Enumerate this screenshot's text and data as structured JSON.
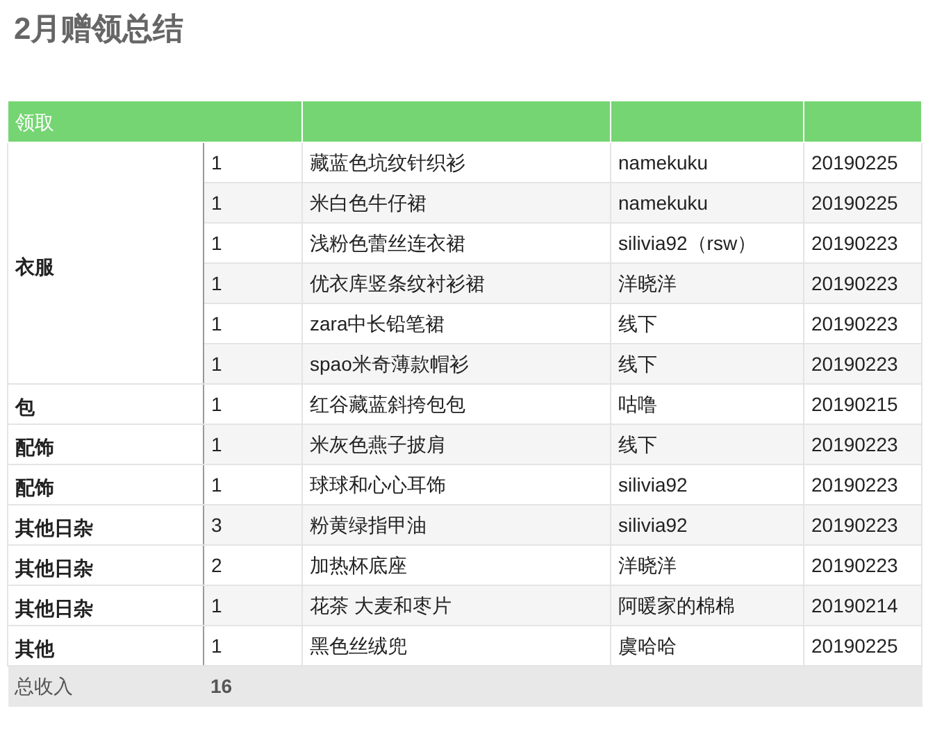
{
  "title": "2月赠领总结",
  "table": {
    "header": "领取",
    "groups": [
      {
        "category": "衣服",
        "items": [
          {
            "qty": "1",
            "item": "藏蓝色坑纹针织衫",
            "source": "namekuku",
            "date": "20190225"
          },
          {
            "qty": "1",
            "item": "米白色牛仔裙",
            "source": "namekuku",
            "date": "20190225"
          },
          {
            "qty": "1",
            "item": "浅粉色蕾丝连衣裙",
            "source": "silivia92（rsw）",
            "date": "20190223"
          },
          {
            "qty": "1",
            "item": "优衣库竖条纹衬衫裙",
            "source": "洋晓洋",
            "date": "20190223"
          },
          {
            "qty": "1",
            "item": "zara中长铅笔裙",
            "source": "线下",
            "date": "20190223"
          },
          {
            "qty": "1",
            "item": "spao米奇薄款帽衫",
            "source": "线下",
            "date": "20190223"
          }
        ]
      },
      {
        "category": "包",
        "items": [
          {
            "qty": "1",
            "item": "红谷藏蓝斜挎包包",
            "source": "咕噜",
            "date": "20190215"
          }
        ]
      },
      {
        "category": "配饰",
        "items": [
          {
            "qty": "1",
            "item": "米灰色燕子披肩",
            "source": "线下",
            "date": "20190223"
          }
        ]
      },
      {
        "category": "配饰",
        "items": [
          {
            "qty": "1",
            "item": "球球和心心耳饰",
            "source": "silivia92",
            "date": "20190223"
          }
        ]
      },
      {
        "category": "其他日杂",
        "items": [
          {
            "qty": "3",
            "item": "粉黄绿指甲油",
            "source": "silivia92",
            "date": "20190223"
          }
        ]
      },
      {
        "category": "其他日杂",
        "items": [
          {
            "qty": "2",
            "item": "加热杯底座",
            "source": "洋晓洋",
            "date": "20190223"
          }
        ]
      },
      {
        "category": "其他日杂",
        "items": [
          {
            "qty": "1",
            "item": "花茶 大麦和枣片",
            "source": "阿暖家的棉棉",
            "date": "20190214"
          }
        ]
      },
      {
        "category": "其他",
        "items": [
          {
            "qty": "1",
            "item": "黑色丝绒兜",
            "source": "虞哈哈",
            "date": "20190225"
          }
        ]
      }
    ],
    "footer": {
      "label": "总收入",
      "total": "16"
    }
  }
}
